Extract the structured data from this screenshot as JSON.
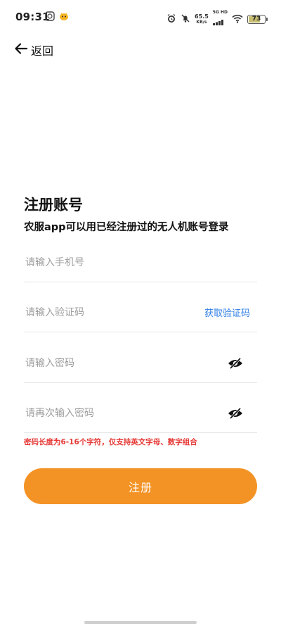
{
  "status_bar": {
    "time": "09:31",
    "net_speed_value": "65.5",
    "net_speed_unit": "KB/s",
    "net_type": "5G HD",
    "battery_level": "73",
    "battery_fraction": 0.73
  },
  "nav": {
    "back_label": "返回"
  },
  "page": {
    "title": "注册账号",
    "subtitle": "农服app可以用已经注册过的无人机账号登录"
  },
  "form": {
    "phone_placeholder": "请输入手机号",
    "code_placeholder": "请输入验证码",
    "get_code_label": "获取验证码",
    "password_placeholder": "请输入密码",
    "password_confirm_placeholder": "请再次输入密码",
    "hint": "密码长度为6-16个字符，仅支持英文字母、数字组合",
    "submit_label": "注册"
  },
  "colors": {
    "accent": "#f39325",
    "link": "#2f7ee6",
    "error": "#e53935"
  }
}
